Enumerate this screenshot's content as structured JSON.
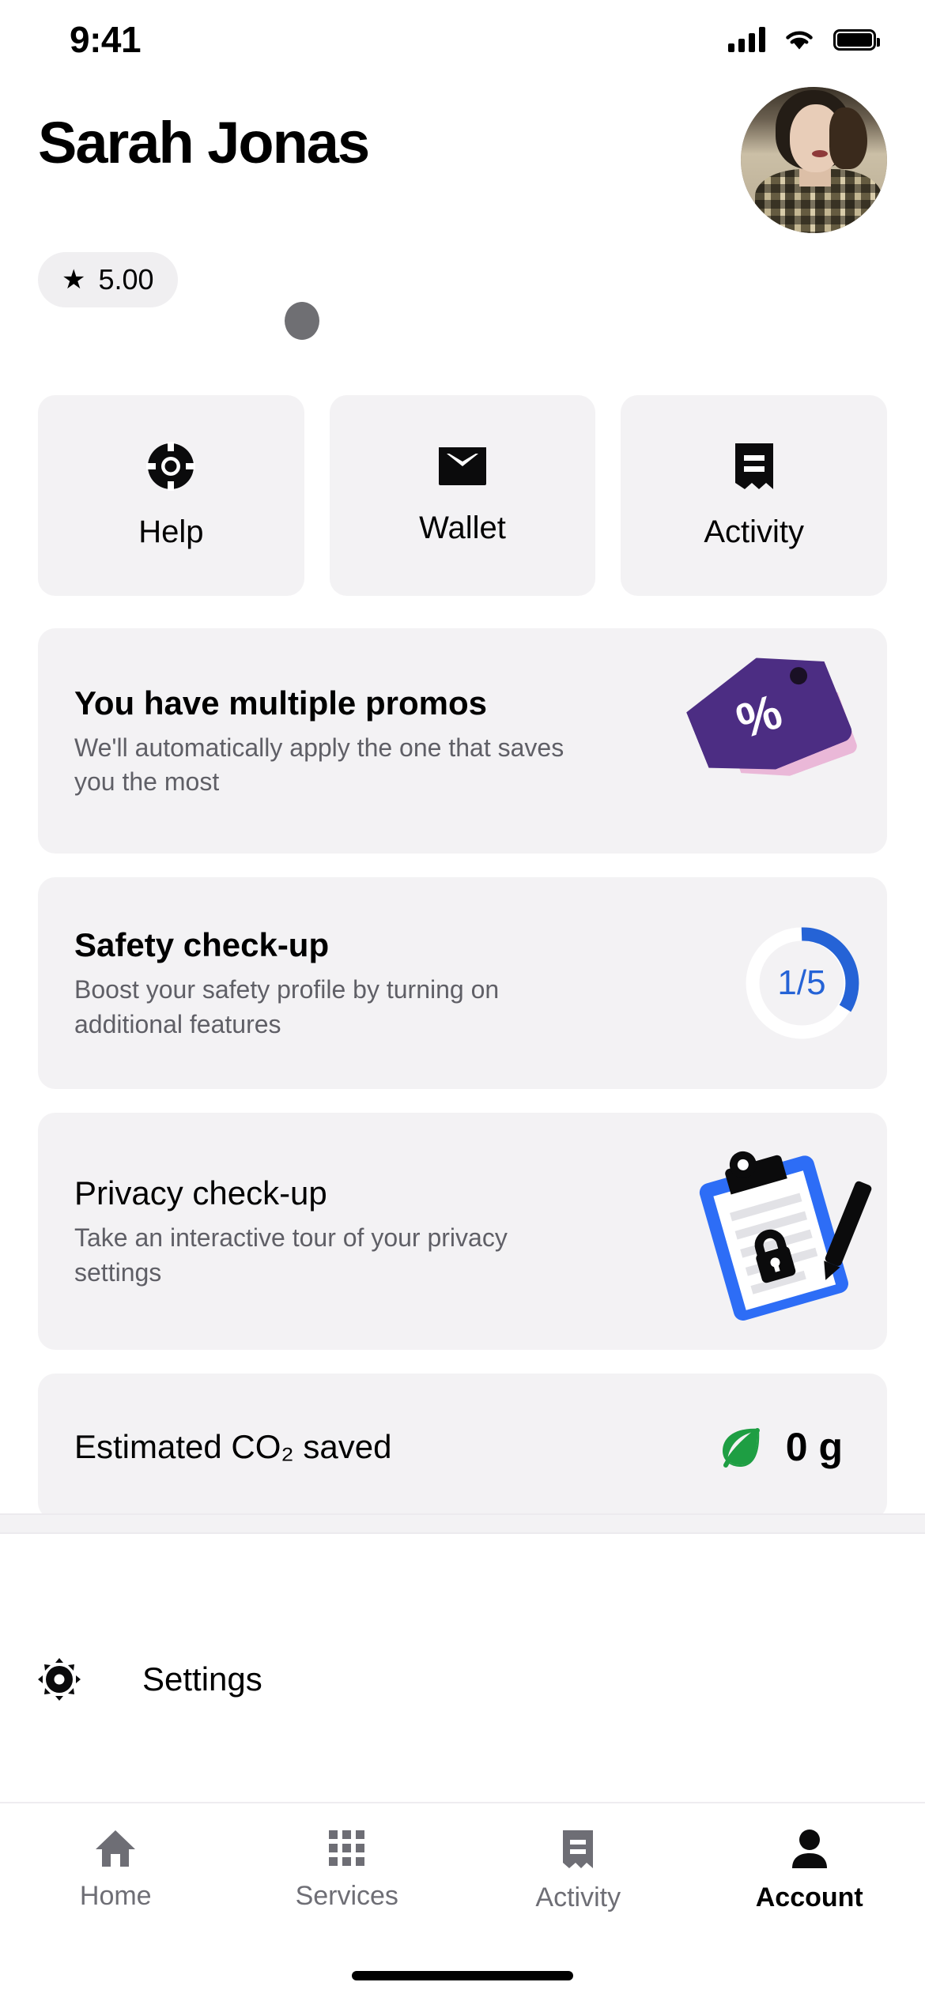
{
  "status_bar": {
    "time": "9:41",
    "icons": [
      "cellular-signal-icon",
      "wifi-icon",
      "battery-icon"
    ]
  },
  "header": {
    "name": "Sarah Jonas",
    "avatar_alt": "avatar",
    "rating": {
      "star_glyph": "★",
      "value": "5.00"
    }
  },
  "quick_actions": [
    {
      "label": "Help",
      "icon": "life-preserver-icon"
    },
    {
      "label": "Wallet",
      "icon": "wallet-icon"
    },
    {
      "label": "Activity",
      "icon": "receipt-icon"
    }
  ],
  "cards": [
    {
      "id": "promos",
      "title": "You have multiple promos",
      "subtitle": "We'll automatically apply the one that saves you the most",
      "art": "promo-tags-illustration",
      "percent_symbol": "%"
    },
    {
      "id": "safety",
      "title": "Safety check-up",
      "subtitle": "Boost your safety profile by turning on additional features",
      "art": "progress-ring",
      "progress_label": "1/5",
      "progress_current": 1,
      "progress_total": 5,
      "progress_color": "#2563d6",
      "track_color": "#ffffff"
    },
    {
      "id": "privacy",
      "title": "Privacy check-up",
      "subtitle": "Take an interactive tour of your privacy settings",
      "art": "clipboard-lock-illustration"
    },
    {
      "id": "co2",
      "title": "Estimated CO₂ saved",
      "value": "0 g",
      "art": "leaf-icon",
      "leaf_color": "#1e9e43"
    }
  ],
  "settings": {
    "label": "Settings",
    "icon": "gear-icon"
  },
  "tab_bar": {
    "items": [
      {
        "label": "Home",
        "icon": "home-icon",
        "active": false
      },
      {
        "label": "Services",
        "icon": "grid-icon",
        "active": false
      },
      {
        "label": "Activity",
        "icon": "receipt-icon",
        "active": false
      },
      {
        "label": "Account",
        "icon": "person-icon",
        "active": true
      }
    ]
  },
  "colors": {
    "card_bg": "#f3f2f4",
    "text_primary": "#000000",
    "text_secondary": "#5f5f66",
    "tab_inactive": "#6e6e75",
    "accent_blue": "#2563d6",
    "promo_purple": "#4c2d83",
    "promo_pink": "#eab8d8",
    "leaf_green": "#1e9e43"
  }
}
